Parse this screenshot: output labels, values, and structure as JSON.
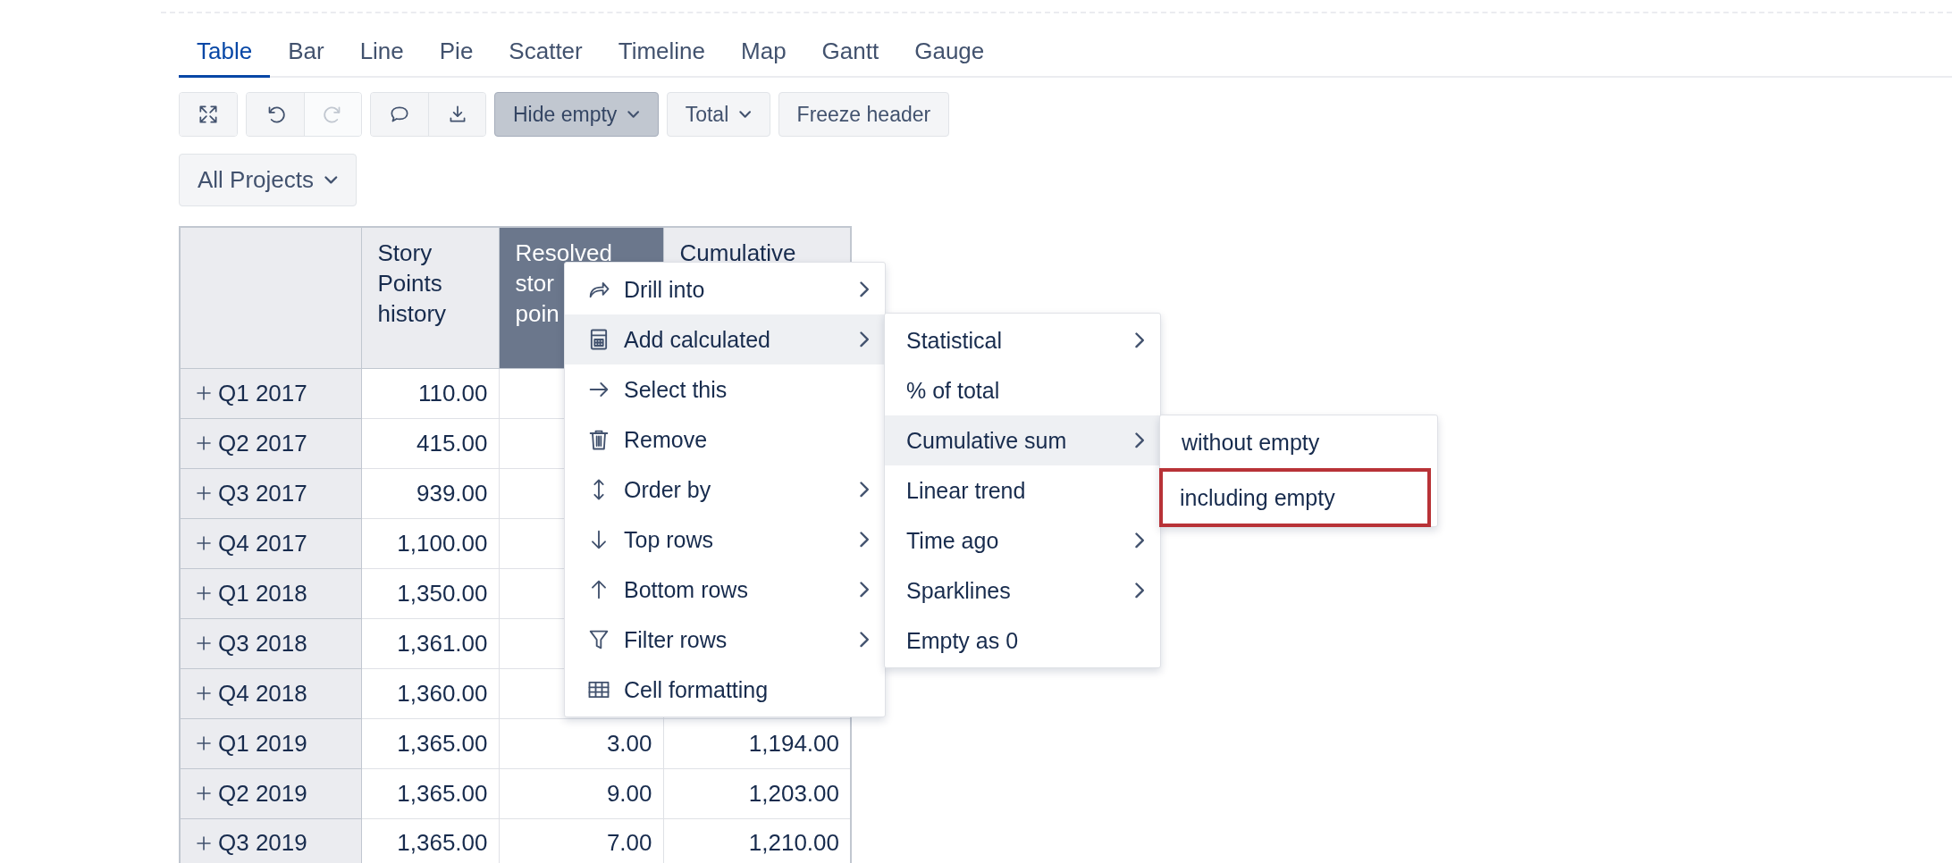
{
  "tabs": [
    {
      "label": "Table",
      "selected": true
    },
    {
      "label": "Bar",
      "selected": false
    },
    {
      "label": "Line",
      "selected": false
    },
    {
      "label": "Pie",
      "selected": false
    },
    {
      "label": "Scatter",
      "selected": false
    },
    {
      "label": "Timeline",
      "selected": false
    },
    {
      "label": "Map",
      "selected": false
    },
    {
      "label": "Gantt",
      "selected": false
    },
    {
      "label": "Gauge",
      "selected": false
    }
  ],
  "toolbar": {
    "icon_groups": [
      [
        {
          "kind": "fullscreen",
          "disabled": false
        }
      ],
      [
        {
          "kind": "undo",
          "disabled": false
        },
        {
          "kind": "redo",
          "disabled": true
        }
      ],
      [
        {
          "kind": "comment",
          "disabled": false
        },
        {
          "kind": "download",
          "disabled": false
        }
      ]
    ],
    "buttons": [
      {
        "label": "Hide empty",
        "selected": true,
        "dropdown": true
      },
      {
        "label": "Total",
        "selected": false,
        "dropdown": true
      },
      {
        "label": "Freeze header",
        "selected": false,
        "dropdown": false
      }
    ]
  },
  "project_filter": {
    "label": "All Projects"
  },
  "table": {
    "columns": [
      {
        "label": "Story Points history",
        "selected": false
      },
      {
        "label": "Resolved stor poin",
        "selected": true
      },
      {
        "label": "Cumulative",
        "selected": false
      }
    ],
    "rows": [
      {
        "label": "Q1 2017",
        "values": [
          "110.00"
        ]
      },
      {
        "label": "Q2 2017",
        "values": [
          "415.00"
        ]
      },
      {
        "label": "Q3 2017",
        "values": [
          "939.00"
        ]
      },
      {
        "label": "Q4 2017",
        "values": [
          "1,100.00"
        ]
      },
      {
        "label": "Q1 2018",
        "values": [
          "1,350.00"
        ]
      },
      {
        "label": "Q3 2018",
        "values": [
          "1,361.00"
        ]
      },
      {
        "label": "Q4 2018",
        "values": [
          "1,360.00"
        ]
      },
      {
        "label": "Q1 2019",
        "values": [
          "1,365.00",
          "3.00",
          "1,194.00"
        ]
      },
      {
        "label": "Q2 2019",
        "values": [
          "1,365.00",
          "9.00",
          "1,203.00"
        ]
      },
      {
        "label": "Q3 2019",
        "values": [
          "1,365.00",
          "7.00",
          "1,210.00"
        ]
      }
    ]
  },
  "context_menu": {
    "items": [
      {
        "label": "Drill into",
        "kind": "drill",
        "submenu": true,
        "highlighted": false
      },
      {
        "label": "Add calculated",
        "kind": "calculator",
        "submenu": true,
        "highlighted": true
      },
      {
        "label": "Select this",
        "kind": "select",
        "submenu": false,
        "highlighted": false
      },
      {
        "label": "Remove",
        "kind": "trash",
        "submenu": false,
        "highlighted": false
      },
      {
        "label": "Order by",
        "kind": "order",
        "submenu": true,
        "highlighted": false
      },
      {
        "label": "Top rows",
        "kind": "top",
        "submenu": true,
        "highlighted": false
      },
      {
        "label": "Bottom rows",
        "kind": "bottom",
        "submenu": true,
        "highlighted": false
      },
      {
        "label": "Filter rows",
        "kind": "filter",
        "submenu": true,
        "highlighted": false
      },
      {
        "label": "Cell formatting",
        "kind": "grid",
        "submenu": false,
        "highlighted": false
      }
    ]
  },
  "calculated_submenu": {
    "items": [
      {
        "label": "Statistical",
        "submenu": true,
        "highlighted": false
      },
      {
        "label": "% of total",
        "submenu": false,
        "highlighted": false
      },
      {
        "label": "Cumulative sum",
        "submenu": true,
        "highlighted": true
      },
      {
        "label": "Linear trend",
        "submenu": false,
        "highlighted": false
      },
      {
        "label": "Time ago",
        "submenu": true,
        "highlighted": false
      },
      {
        "label": "Sparklines",
        "submenu": true,
        "highlighted": false
      },
      {
        "label": "Empty as 0",
        "submenu": false,
        "highlighted": false
      }
    ]
  },
  "cumulative_submenu": {
    "items": [
      {
        "label": "without empty",
        "submenu": false,
        "highlighted": false,
        "outlined": false
      },
      {
        "label": "including empty",
        "submenu": false,
        "highlighted": false,
        "outlined": true
      }
    ]
  }
}
